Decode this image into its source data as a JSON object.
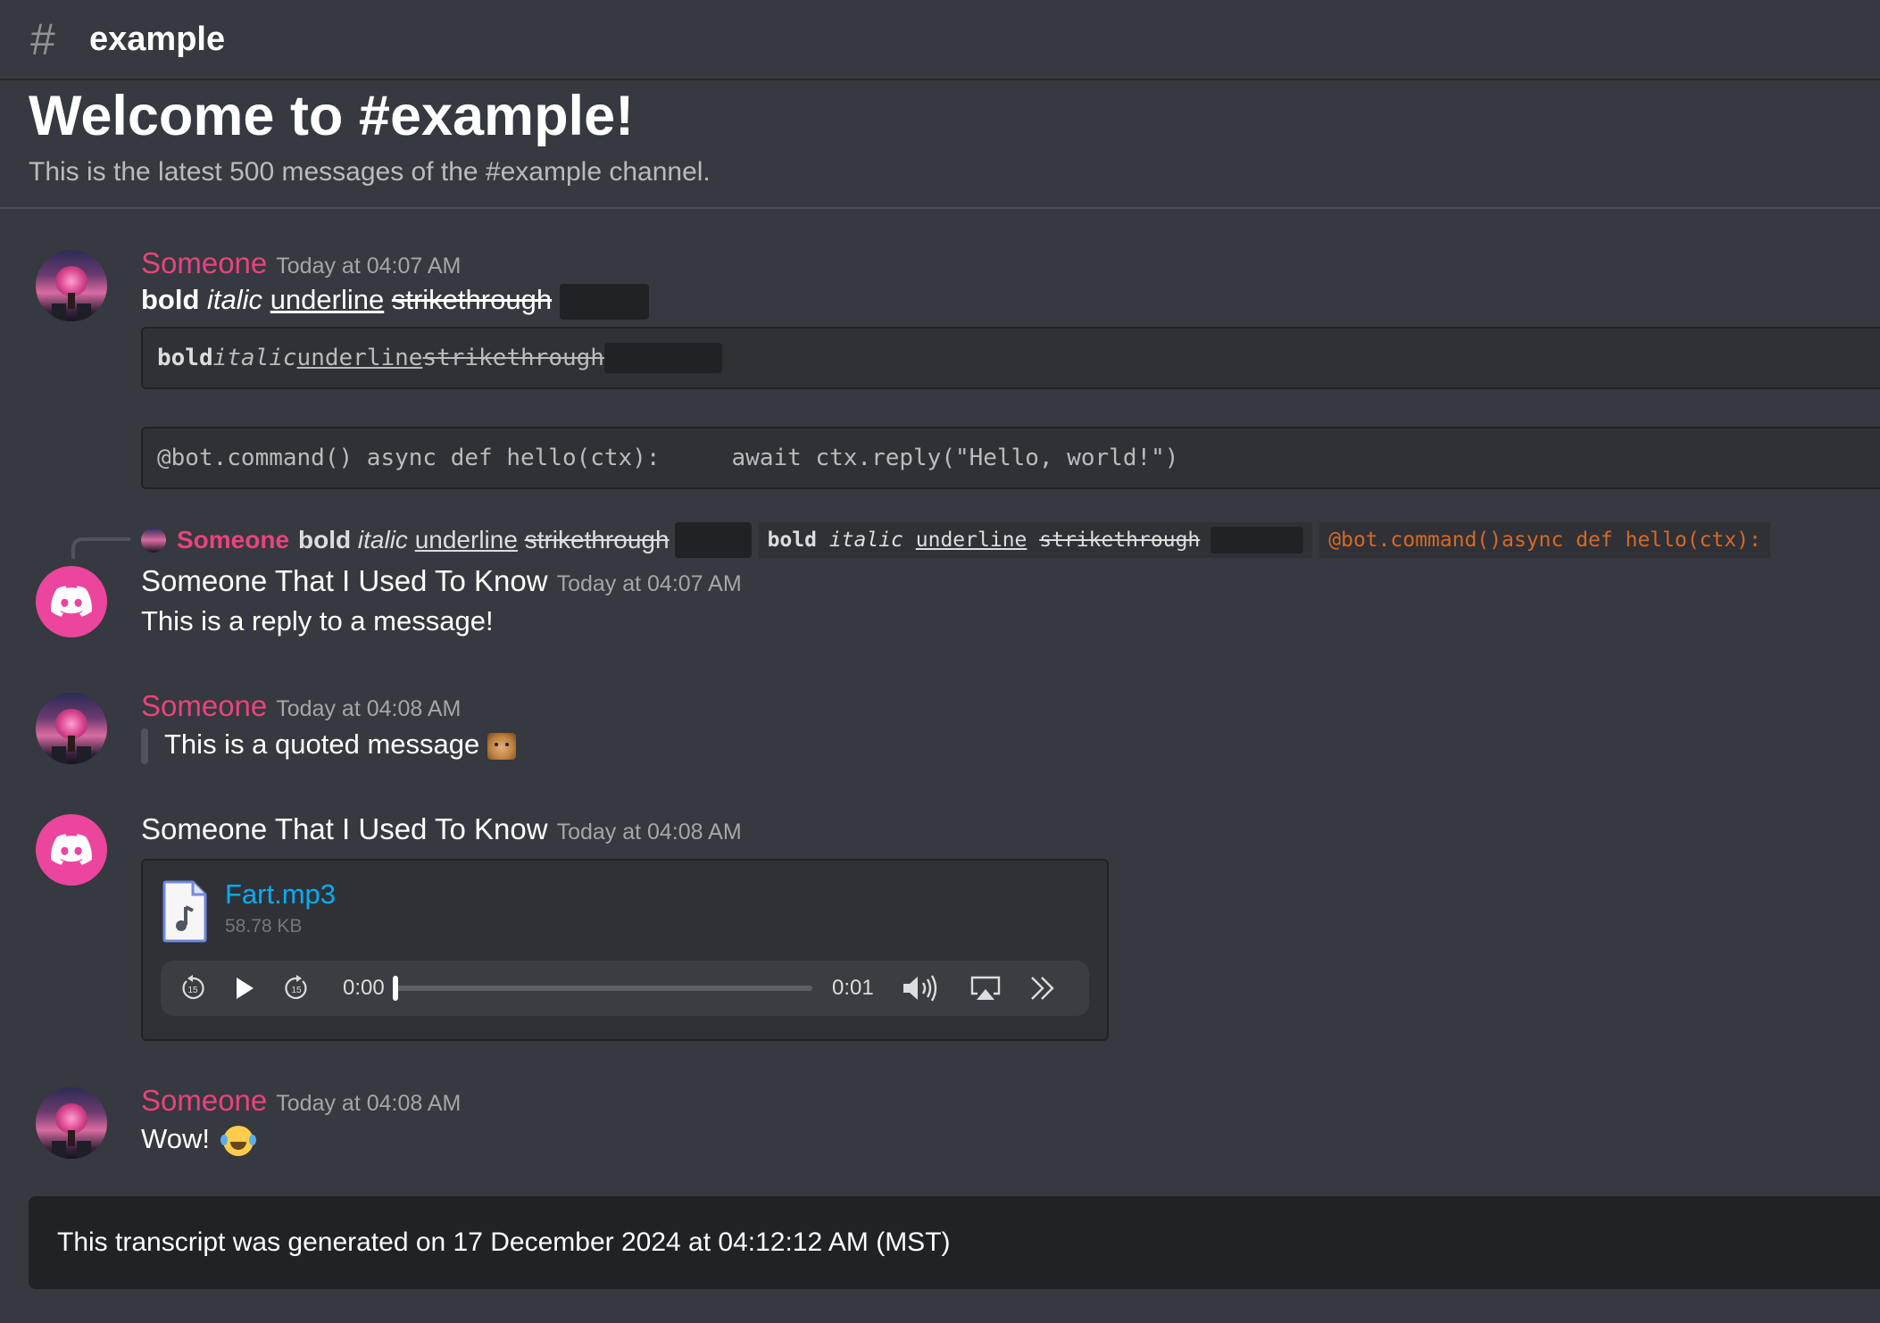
{
  "header": {
    "hash_icon": "#",
    "channel_name": "example"
  },
  "welcome": {
    "title": "Welcome to #example!",
    "subtitle": "This is the latest 500 messages of the #example channel."
  },
  "format": {
    "bold": "bold",
    "italic": "italic",
    "underline": "underline",
    "strikethrough": "strikethrough"
  },
  "messages": [
    {
      "author": "Someone",
      "timestamp": "Today at 04:07 AM",
      "code_line_1": "@bot.command() async def hello(ctx):",
      "code_line_2": "await ctx.reply(\"Hello, world!\")"
    },
    {
      "author": "Someone That I Used To Know",
      "timestamp": "Today at 04:07 AM",
      "reply_to": {
        "author": "Someone",
        "code_snippet": "@bot.command()async def hello(ctx):"
      },
      "text": "This is a reply to a message!"
    },
    {
      "author": "Someone",
      "timestamp": "Today at 04:08 AM",
      "quote": "This is a quoted message"
    },
    {
      "author": "Someone That I Used To Know",
      "timestamp": "Today at 04:08 AM",
      "attachment": {
        "file_name": "Fart.mp3",
        "file_size": "58.78 KB",
        "current_time": "0:00",
        "duration": "0:01",
        "progress": 0,
        "skip_back_label": "15",
        "skip_forward_label": "15"
      }
    },
    {
      "author": "Someone",
      "timestamp": "Today at 04:08 AM",
      "text": "Wow!"
    }
  ],
  "footer": {
    "text": "This transcript was generated on 17 December 2024 at 04:12:12 AM (MST)"
  },
  "colors": {
    "background": "#36393f",
    "username_pink": "#e84282",
    "link_blue": "#00aff4",
    "code_orange": "#d4692a",
    "discord_avatar": "#eb459e"
  }
}
